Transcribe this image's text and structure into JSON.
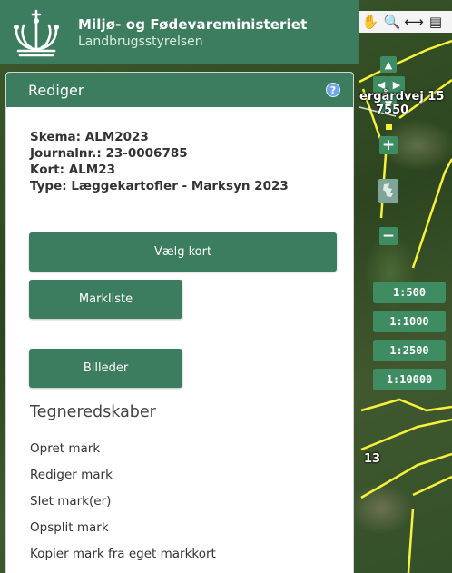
{
  "header": {
    "title": "Miljø- og Fødevareministeriet",
    "subtitle": "Landbrugsstyrelsen"
  },
  "panel": {
    "title": "Rediger",
    "help_icon": "question-circle-icon",
    "info": {
      "skema": "Skema: ALM2023",
      "journalnr": "Journalnr.: 23-0006785",
      "kort": "Kort: ALM23",
      "type": "Type: Læggekartofler - Marksyn 2023"
    },
    "buttons": {
      "vaelg_kort": "Vælg kort",
      "markliste": "Markliste",
      "billeder": "Billeder"
    },
    "section_title": "Tegneredskaber",
    "tools": [
      "Opret mark",
      "Rediger mark",
      "Slet mark(er)",
      "Opsplit mark",
      "Kopier mark fra eget markkort"
    ]
  },
  "map": {
    "toolbar_icons": [
      "pan-hand-icon",
      "zoom-magnifier-icon",
      "measure-icon",
      "print-icon"
    ],
    "nav": {
      "up": "▲",
      "left": "◀",
      "right": "▶",
      "down": "▼",
      "zoom_in": "+",
      "zoom_out": "−"
    },
    "scales": [
      "1:500",
      "1:1000",
      "1:2500",
      "1:10000"
    ],
    "labels": {
      "road": "ergårdvej 15",
      "postal": "7550",
      "parcel": "13"
    },
    "boundary_color": "#f7f13b"
  }
}
